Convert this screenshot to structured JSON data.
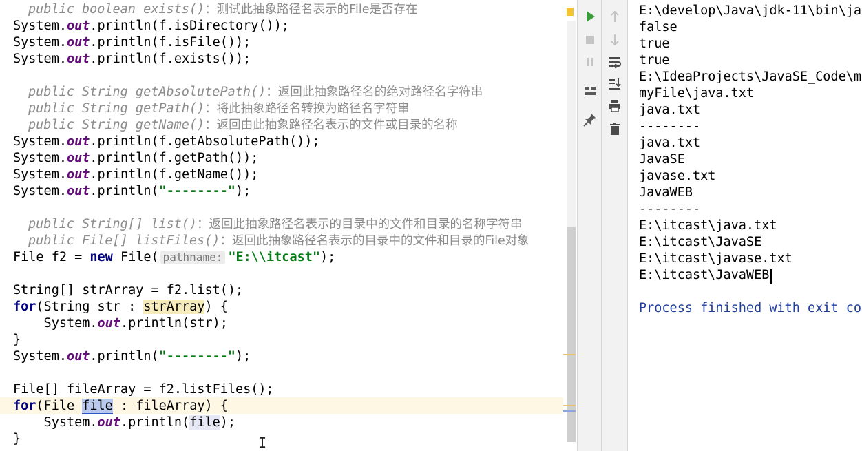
{
  "editor": {
    "lines": [
      {
        "type": "comment",
        "sig": "public boolean exists()",
        "desc": "：测试此抽象路径名表示的File是否存在"
      },
      {
        "type": "code",
        "parts": [
          {
            "t": "System."
          },
          {
            "t": "out",
            "c": "fld"
          },
          {
            "t": ".println(f.isDirectory());"
          }
        ]
      },
      {
        "type": "code",
        "parts": [
          {
            "t": "System."
          },
          {
            "t": "out",
            "c": "fld"
          },
          {
            "t": ".println(f.isFile());"
          }
        ]
      },
      {
        "type": "code",
        "parts": [
          {
            "t": "System."
          },
          {
            "t": "out",
            "c": "fld"
          },
          {
            "t": ".println(f.exists());"
          }
        ]
      },
      {
        "type": "blank"
      },
      {
        "type": "comment",
        "sig": "public String getAbsolutePath()",
        "desc": "：返回此抽象路径名的绝对路径名字符串"
      },
      {
        "type": "comment",
        "sig": "public String getPath()",
        "desc": "：将此抽象路径名转换为路径名字符串"
      },
      {
        "type": "comment",
        "sig": "public String getName()",
        "desc": "：返回由此抽象路径名表示的文件或目录的名称"
      },
      {
        "type": "code",
        "parts": [
          {
            "t": "System."
          },
          {
            "t": "out",
            "c": "fld"
          },
          {
            "t": ".println(f.getAbsolutePath());"
          }
        ]
      },
      {
        "type": "code",
        "parts": [
          {
            "t": "System."
          },
          {
            "t": "out",
            "c": "fld"
          },
          {
            "t": ".println(f.getPath());"
          }
        ]
      },
      {
        "type": "code",
        "parts": [
          {
            "t": "System."
          },
          {
            "t": "out",
            "c": "fld"
          },
          {
            "t": ".println(f.getName());"
          }
        ]
      },
      {
        "type": "code",
        "parts": [
          {
            "t": "System."
          },
          {
            "t": "out",
            "c": "fld"
          },
          {
            "t": ".println("
          },
          {
            "t": "\"--------\"",
            "c": "s"
          },
          {
            "t": ");"
          }
        ]
      },
      {
        "type": "blank"
      },
      {
        "type": "comment",
        "sig": "public String[] list()",
        "desc": "：返回此抽象路径名表示的目录中的文件和目录的名称字符串"
      },
      {
        "type": "comment",
        "sig": "public File[] listFiles()",
        "desc": "：返回此抽象路径名表示的目录中的文件和目录的File对象"
      },
      {
        "type": "code",
        "parts": [
          {
            "t": "File f2 = "
          },
          {
            "t": "new",
            "c": "k"
          },
          {
            "t": " File("
          },
          {
            "t": "pathname:",
            "c": "hint"
          },
          {
            "t": "\"E:\\\\itcast\"",
            "c": "s"
          },
          {
            "t": ");"
          }
        ]
      },
      {
        "type": "blank"
      },
      {
        "type": "code",
        "parts": [
          {
            "t": "String[] strArray = f2.list();"
          }
        ]
      },
      {
        "type": "code",
        "parts": [
          {
            "t": "for",
            "c": "k"
          },
          {
            "t": "(String str : "
          },
          {
            "t": "strArray",
            "c": "hl-yellow"
          },
          {
            "t": ") {"
          }
        ]
      },
      {
        "type": "code",
        "parts": [
          {
            "t": "    System."
          },
          {
            "t": "out",
            "c": "fld"
          },
          {
            "t": ".println(str);"
          }
        ]
      },
      {
        "type": "code",
        "parts": [
          {
            "t": "}"
          }
        ]
      },
      {
        "type": "code",
        "parts": [
          {
            "t": "System."
          },
          {
            "t": "out",
            "c": "fld"
          },
          {
            "t": ".println("
          },
          {
            "t": "\"--------\"",
            "c": "s"
          },
          {
            "t": ");"
          }
        ]
      },
      {
        "type": "blank"
      },
      {
        "type": "code",
        "parts": [
          {
            "t": "File[] fileArray = f2.listFiles();"
          }
        ]
      },
      {
        "type": "code",
        "parts": [
          {
            "t": "for",
            "c": "k"
          },
          {
            "t": "(File "
          },
          {
            "t": "file",
            "c": "hl-sel"
          },
          {
            "t": " : fileArray) {"
          }
        ]
      },
      {
        "type": "code",
        "parts": [
          {
            "t": "    System."
          },
          {
            "t": "out",
            "c": "fld"
          },
          {
            "t": ".println("
          },
          {
            "t": "file",
            "c": "hl-use"
          },
          {
            "t": ");"
          }
        ]
      },
      {
        "type": "code",
        "parts": [
          {
            "t": "}"
          }
        ]
      }
    ]
  },
  "console": {
    "lines": [
      "E:\\develop\\Java\\jdk-11\\bin\\ja",
      "false",
      "true",
      "true",
      "E:\\IdeaProjects\\JavaSE_Code\\m",
      "myFile\\java.txt",
      "java.txt",
      "--------",
      "java.txt",
      "JavaSE",
      "javase.txt",
      "JavaWEB",
      "--------",
      "E:\\itcast\\java.txt",
      "E:\\itcast\\JavaSE",
      "E:\\itcast\\javase.txt",
      "E:\\itcast\\JavaWEB",
      "",
      "Process finished with exit co"
    ]
  },
  "toolbar": {
    "left": [
      "run-icon",
      "stop-icon",
      "pause-icon",
      "layout-icon",
      "pin-icon"
    ],
    "right": [
      "arrow-up-icon",
      "arrow-down-icon",
      "soft-wrap-icon",
      "scroll-to-end-icon",
      "print-icon",
      "trash-icon"
    ]
  },
  "colors": {
    "keyword": "#000080",
    "field": "#660e7a",
    "string": "#067d17",
    "comment": "#8c8c8c",
    "run_green": "#3c9a3c",
    "exit_text": "#1f3e9e",
    "current_line": "#fdf7e4"
  }
}
